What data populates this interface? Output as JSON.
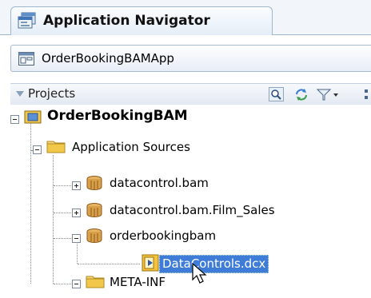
{
  "navigator": {
    "title": "Application Navigator"
  },
  "application": {
    "name": "OrderBookingBAMApp"
  },
  "projects_panel": {
    "label": "Projects"
  },
  "tree": {
    "root": "OrderBookingBAM",
    "app_sources": "Application Sources",
    "item_datacontrol": "datacontrol.bam",
    "item_film_sales": "datacontrol.bam.Film_Sales",
    "item_orderbooking": "orderbookingbam",
    "item_dcx": "DataControls.dcx",
    "item_meta": "META-INF"
  },
  "colors": {
    "selection": "#3e7cd8",
    "folder": "#f2c84b",
    "package": "#d9a04a",
    "accent_border": "#9fb6cf"
  }
}
